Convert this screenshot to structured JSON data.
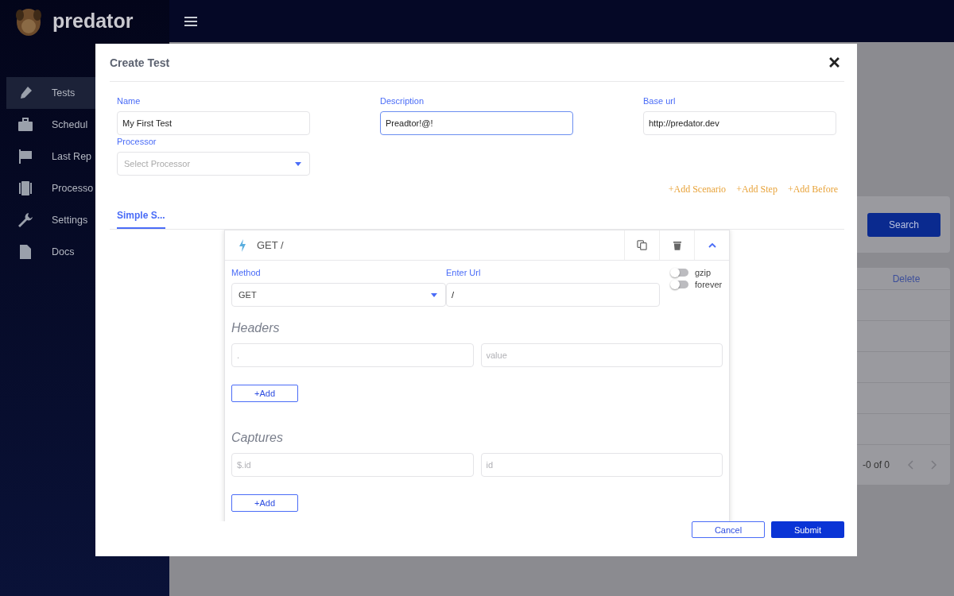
{
  "app": {
    "logo_text": "predator"
  },
  "sidebar": {
    "items": [
      {
        "label": "Tests",
        "selected": true
      },
      {
        "label": "Schedul",
        "selected": false
      },
      {
        "label": "Last Rep",
        "selected": false
      },
      {
        "label": "Processo",
        "selected": false
      },
      {
        "label": "Settings",
        "selected": false
      },
      {
        "label": "Docs",
        "selected": false
      }
    ]
  },
  "background": {
    "search_button": "Search",
    "table": {
      "column": "Delete"
    },
    "pagination": "-0 of 0"
  },
  "modal": {
    "title": "Create Test",
    "fields": [
      {
        "label": "Name",
        "value": "My First Test",
        "focused": false
      },
      {
        "label": "Description",
        "value": "Preadtor!@!",
        "focused": true
      },
      {
        "label": "Base url",
        "value": "http://predator.dev",
        "focused": false
      }
    ],
    "processor": {
      "label": "Processor",
      "placeholder": "Select Processor"
    },
    "actions": [
      "+Add Scenario",
      "+Add Step",
      "+Add Before"
    ],
    "tabs": [
      {
        "label": "Simple S...",
        "selected": true
      }
    ],
    "step": {
      "title": "GET /",
      "expanded": true,
      "method": {
        "label": "Method",
        "value": "GET"
      },
      "url": {
        "label": "Enter Url",
        "value": "/"
      },
      "toggles": [
        {
          "label": "gzip",
          "on": false
        },
        {
          "label": "forever",
          "on": false
        }
      ],
      "sections": [
        {
          "title": "Headers",
          "fields": [
            {
              "placeholder": "."
            },
            {
              "placeholder": "value"
            }
          ],
          "add": "+Add"
        },
        {
          "title": "Captures",
          "fields": [
            {
              "placeholder": "$.id"
            },
            {
              "placeholder": "id"
            }
          ],
          "add": "+Add"
        }
      ]
    },
    "buttons": [
      {
        "label": "Cancel",
        "kind": "secondary"
      },
      {
        "label": "Submit",
        "kind": "primary"
      }
    ]
  }
}
